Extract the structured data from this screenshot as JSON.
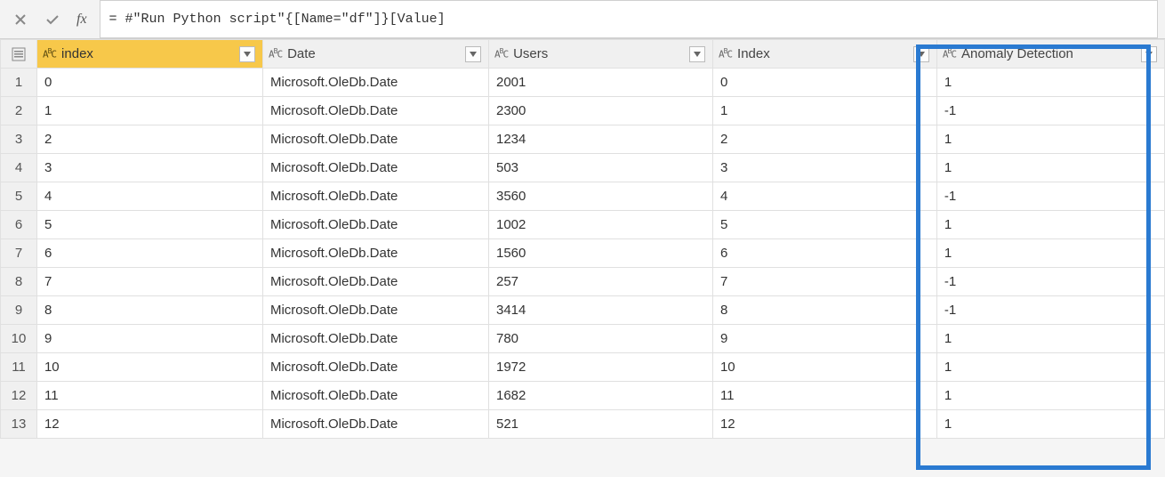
{
  "formula_bar": {
    "fx_label": "fx",
    "formula": "= #\"Run Python script\"{[Name=\"df\"]}[Value]"
  },
  "columns": [
    {
      "name": "index",
      "type": "ABC",
      "selected": true
    },
    {
      "name": "Date",
      "type": "ABC",
      "selected": false
    },
    {
      "name": "Users",
      "type": "ABC",
      "selected": false
    },
    {
      "name": "Index",
      "type": "ABC",
      "selected": false
    },
    {
      "name": "Anomaly Detection",
      "type": "ABC",
      "selected": false
    }
  ],
  "rows": [
    {
      "n": "1",
      "cells": [
        "0",
        "Microsoft.OleDb.Date",
        "2001",
        "0",
        "1"
      ]
    },
    {
      "n": "2",
      "cells": [
        "1",
        "Microsoft.OleDb.Date",
        "2300",
        "1",
        "-1"
      ]
    },
    {
      "n": "3",
      "cells": [
        "2",
        "Microsoft.OleDb.Date",
        "1234",
        "2",
        "1"
      ]
    },
    {
      "n": "4",
      "cells": [
        "3",
        "Microsoft.OleDb.Date",
        "503",
        "3",
        "1"
      ]
    },
    {
      "n": "5",
      "cells": [
        "4",
        "Microsoft.OleDb.Date",
        "3560",
        "4",
        "-1"
      ]
    },
    {
      "n": "6",
      "cells": [
        "5",
        "Microsoft.OleDb.Date",
        "1002",
        "5",
        "1"
      ]
    },
    {
      "n": "7",
      "cells": [
        "6",
        "Microsoft.OleDb.Date",
        "1560",
        "6",
        "1"
      ]
    },
    {
      "n": "8",
      "cells": [
        "7",
        "Microsoft.OleDb.Date",
        "257",
        "7",
        "-1"
      ]
    },
    {
      "n": "9",
      "cells": [
        "8",
        "Microsoft.OleDb.Date",
        "3414",
        "8",
        "-1"
      ]
    },
    {
      "n": "10",
      "cells": [
        "9",
        "Microsoft.OleDb.Date",
        "780",
        "9",
        "1"
      ]
    },
    {
      "n": "11",
      "cells": [
        "10",
        "Microsoft.OleDb.Date",
        "1972",
        "10",
        "1"
      ]
    },
    {
      "n": "12",
      "cells": [
        "11",
        "Microsoft.OleDb.Date",
        "1682",
        "11",
        "1"
      ]
    },
    {
      "n": "13",
      "cells": [
        "12",
        "Microsoft.OleDb.Date",
        "521",
        "12",
        "1"
      ]
    }
  ],
  "highlighted_column": 4
}
